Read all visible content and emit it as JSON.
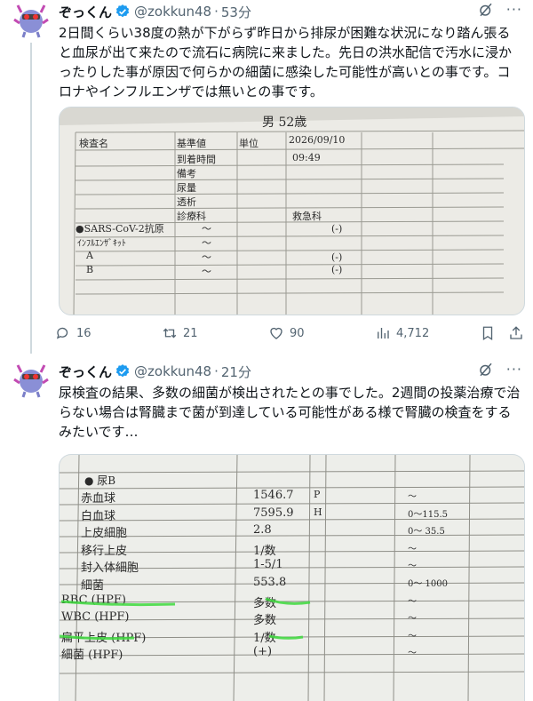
{
  "tweets": [
    {
      "author_name": "ぞっくん",
      "handle": "@zokkun48",
      "time": "53分",
      "text": "2日間くらい38度の熱が下がらず昨日から排尿が困難な状況になり踏ん張ると血尿が出て来たので流石に病院に来ました。先日の洪水配信で汚水に浸かったりした事が原因で何らかの細菌に感染した可能性が高いとの事です。コロナやインフルエンザでは無いとの事です。",
      "photo": {
        "top_line": "男  52歳",
        "header_row": [
          "検査名",
          "基準値",
          "単位",
          "2026/09/10"
        ],
        "row_arrival": {
          "label": "到着時間",
          "value": "09:49"
        },
        "row_labels": [
          "備考",
          "尿量",
          "透析",
          "診療科"
        ],
        "dept_value": "救急科",
        "tests": [
          {
            "name": "●SARS-CoV-2抗原",
            "ref": "～",
            "result": "(-)"
          },
          {
            "name": "ｲﾝﾌﾙｴﾝｻﾞｷｯﾄ",
            "ref": "～",
            "result": ""
          },
          {
            "name": "A",
            "ref": "～",
            "result": "(-)"
          },
          {
            "name": "B",
            "ref": "～",
            "result": "(-)"
          }
        ]
      },
      "stats": {
        "replies": "16",
        "retweets": "21",
        "likes": "90",
        "views": "4,712"
      }
    },
    {
      "author_name": "ぞっくん",
      "handle": "@zokkun48",
      "time": "21分",
      "text": "尿検査の結果、多数の細菌が検出されたとの事でした。2週間の投薬治療で治らない場合は腎臓まで菌が到達している可能性がある様で腎臓の検査をするみたいです…",
      "photo": {
        "section": "●  尿B",
        "rows": [
          {
            "name": "赤血球",
            "value": "1546.7",
            "flag": "P",
            "ref": "～"
          },
          {
            "name": "白血球",
            "value": "7595.9",
            "flag": "H",
            "ref": "0～115.5"
          },
          {
            "name": "上皮細胞",
            "value": "2.8",
            "flag": "",
            "ref": "0～ 35.5"
          },
          {
            "name": "移行上皮",
            "value": "1/数",
            "flag": "",
            "ref": "～"
          },
          {
            "name": "封入体細胞",
            "value": "1-5/1",
            "flag": "",
            "ref": "～"
          },
          {
            "name": "細菌",
            "value": "553.8",
            "flag": "",
            "ref": "0～ 1000"
          },
          {
            "name": "RBC (HPF)",
            "value": "多数",
            "flag": "",
            "ref": "～"
          },
          {
            "name": "WBC (HPF)",
            "value": "多数",
            "flag": "",
            "ref": "～"
          },
          {
            "name": "扁平上皮 (HPF)",
            "value": "1/数",
            "flag": "",
            "ref": "～"
          },
          {
            "name": "細菌 (HPF)",
            "value": "(+)",
            "flag": "",
            "ref": "～"
          }
        ]
      }
    }
  ],
  "colors": {
    "highlighter": "#3dd93d",
    "verified": "#1d9bf0",
    "muted": "#536471"
  }
}
